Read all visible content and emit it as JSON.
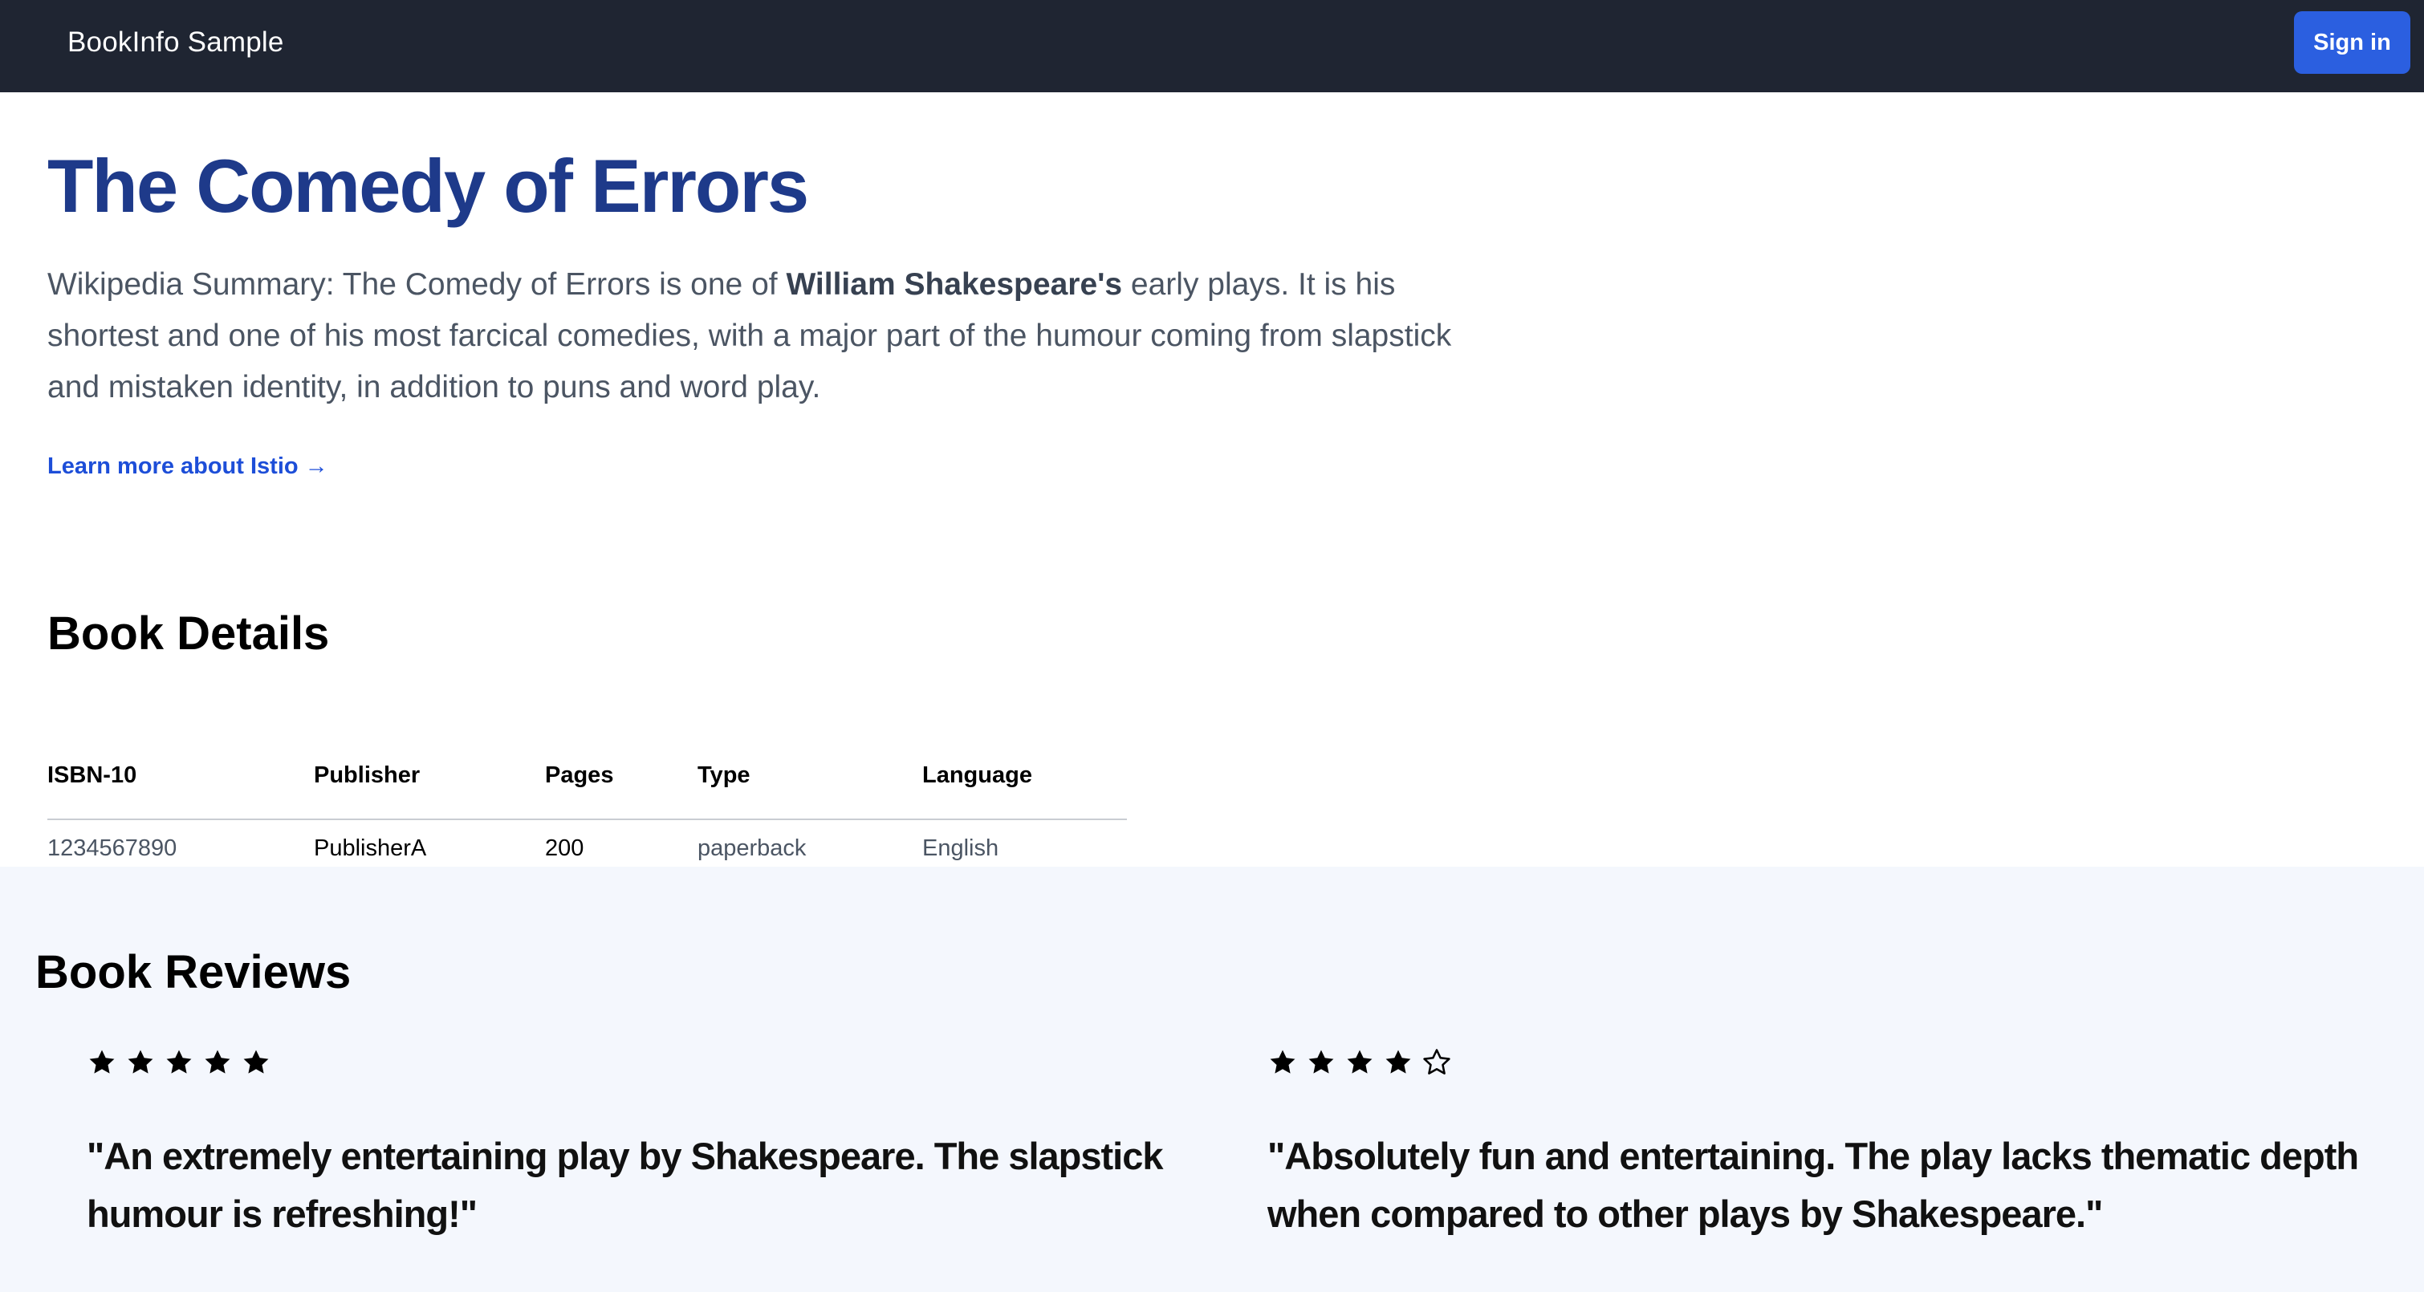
{
  "navbar": {
    "brand": "BookInfo Sample",
    "signin_label": "Sign in"
  },
  "book": {
    "title": "The Comedy of Errors",
    "summary_before": "Wikipedia Summary: The Comedy of Errors is one of ",
    "summary_bold": "William Shakespeare's",
    "summary_after": " early plays. It is his shortest and one of his most farcical comedies, with a major part of the humour coming from slapstick and mistaken identity, in addition to puns and word play.",
    "learn_more": "Learn more about Istio →"
  },
  "details": {
    "heading": "Book Details",
    "columns": [
      "ISBN-10",
      "Publisher",
      "Pages",
      "Type",
      "Language"
    ],
    "row": [
      "1234567890",
      "PublisherA",
      "200",
      "paperback",
      "English"
    ]
  },
  "reviews": {
    "heading": "Book Reviews",
    "items": [
      {
        "rating": 5,
        "max": 5,
        "text": "\"An extremely entertaining play by Shakespeare. The slapstick humour is refreshing!\""
      },
      {
        "rating": 4,
        "max": 5,
        "text": "\"Absolutely fun and entertaining. The play lacks thematic depth when compared to other plays by Shakespeare.\""
      }
    ]
  },
  "colors": {
    "navbar_bg": "#1f2532",
    "accent": "#2b5fe0",
    "title": "#1e3a8a",
    "link": "#1d4ed8",
    "reviews_bg": "#f4f7fd"
  },
  "icons": {
    "filled": "star-filled-icon",
    "empty": "star-outline-icon"
  }
}
